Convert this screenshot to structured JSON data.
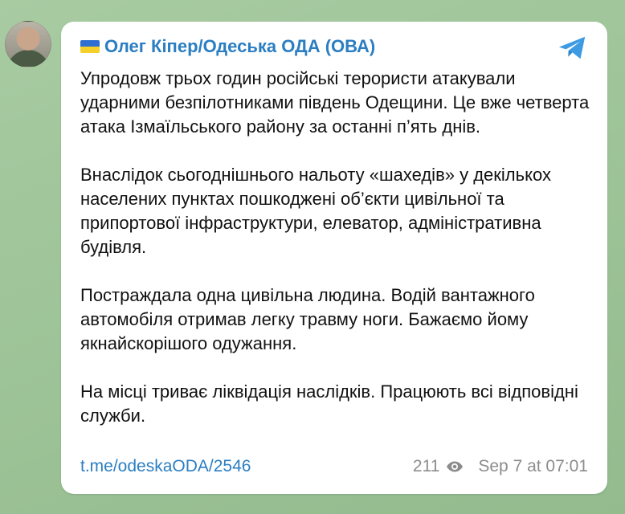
{
  "channel": {
    "flag_icon": "ukraine-flag-icon",
    "name": "Олег Кіпер/Одеська ОДА (ОВА)",
    "avatar_icon": "channel-avatar"
  },
  "message": {
    "paragraphs": [
      "Упродовж трьох годин російські терористи атакували ударними безпілотниками південь Одещини. Це вже четверта атака Ізмаїльського району за останні п’ять днів.",
      "Внаслідок сьогоднішнього нальоту «шахедів» у декількох населених пунктах пошкоджені об’єкти цивільної та припортової інфраструктури, елеватор, адміністративна будівля.",
      "Постраждала одна цивільна людина. Водій вантажного автомобіля отримав легку травму ноги. Бажаємо йому якнайскорішого одужання.",
      "На місці триває ліквідація наслідків. Працюють всі відповідні служби."
    ]
  },
  "footer": {
    "link": "t.me/odeskaODA/2546",
    "views": "211",
    "date": "Sep 7 at 07:01"
  },
  "colors": {
    "accent": "#2b7ec2",
    "background": "#9fc39a",
    "meta": "#8c8c8c"
  }
}
